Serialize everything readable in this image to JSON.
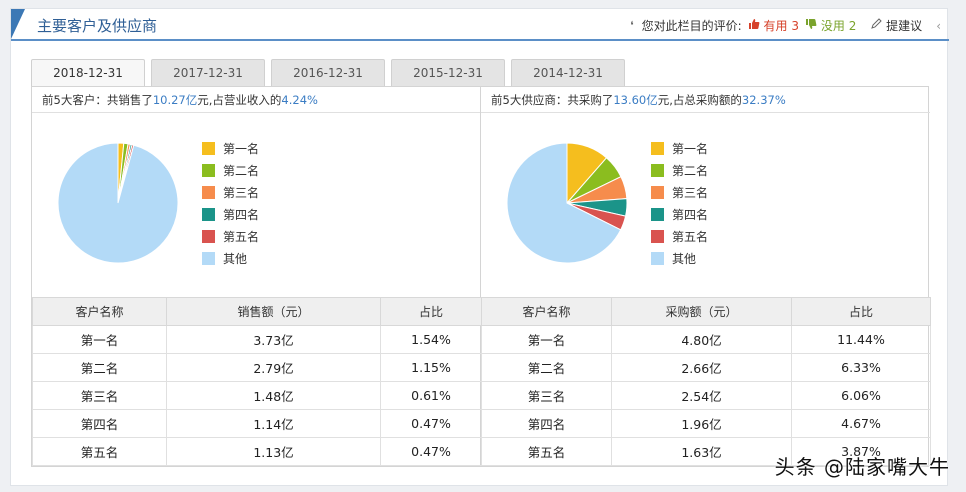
{
  "header": {
    "title": "主要客户及供应商",
    "rate_prompt": "您对此栏目的评价:",
    "useful_label": "有用",
    "useful_count": "3",
    "useless_label": "没用",
    "useless_count": "2",
    "suggest_label": "提建议",
    "more_label": "‹"
  },
  "tabs": [
    {
      "label": "2018-12-31",
      "active": true
    },
    {
      "label": "2017-12-31",
      "active": false
    },
    {
      "label": "2016-12-31",
      "active": false
    },
    {
      "label": "2015-12-31",
      "active": false
    },
    {
      "label": "2014-12-31",
      "active": false
    }
  ],
  "customers": {
    "summary_prefix": "前5大客户：共销售了",
    "summary_amount": "10.27亿",
    "summary_mid": "元,占营业收入的",
    "summary_pct": "4.24%",
    "legend": [
      "第一名",
      "第二名",
      "第三名",
      "第四名",
      "第五名",
      "其他"
    ],
    "columns": [
      "客户名称",
      "销售额（元）",
      "占比"
    ],
    "rows": [
      [
        "第一名",
        "3.73亿",
        "1.54%"
      ],
      [
        "第二名",
        "2.79亿",
        "1.15%"
      ],
      [
        "第三名",
        "1.48亿",
        "0.61%"
      ],
      [
        "第四名",
        "1.14亿",
        "0.47%"
      ],
      [
        "第五名",
        "1.13亿",
        "0.47%"
      ]
    ]
  },
  "suppliers": {
    "summary_prefix": "前5大供应商：共采购了",
    "summary_amount": "13.60亿",
    "summary_mid": "元,占总采购额的",
    "summary_pct": "32.37%",
    "legend": [
      "第一名",
      "第二名",
      "第三名",
      "第四名",
      "第五名",
      "其他"
    ],
    "columns": [
      "客户名称",
      "采购额（元）",
      "占比"
    ],
    "rows": [
      [
        "第一名",
        "4.80亿",
        "11.44%"
      ],
      [
        "第二名",
        "2.66亿",
        "6.33%"
      ],
      [
        "第三名",
        "2.54亿",
        "6.06%"
      ],
      [
        "第四名",
        "1.96亿",
        "4.67%"
      ],
      [
        "第五名",
        "1.63亿",
        "3.87%"
      ]
    ]
  },
  "chart_data": [
    {
      "type": "pie",
      "categories": [
        "第一名",
        "第二名",
        "第三名",
        "第四名",
        "第五名",
        "其他"
      ],
      "values": [
        1.54,
        1.15,
        0.61,
        0.47,
        0.47,
        95.76
      ],
      "colors": [
        "#f5be1e",
        "#8bbd1f",
        "#f68c4c",
        "#1b9489",
        "#d9534f",
        "#b3daf7"
      ]
    },
    {
      "type": "pie",
      "categories": [
        "第一名",
        "第二名",
        "第三名",
        "第四名",
        "第五名",
        "其他"
      ],
      "values": [
        11.44,
        6.33,
        6.06,
        4.67,
        3.87,
        67.63
      ],
      "colors": [
        "#f5be1e",
        "#8bbd1f",
        "#f68c4c",
        "#1b9489",
        "#d9534f",
        "#b3daf7"
      ]
    }
  ],
  "watermark": "头条 @陆家嘴大牛"
}
